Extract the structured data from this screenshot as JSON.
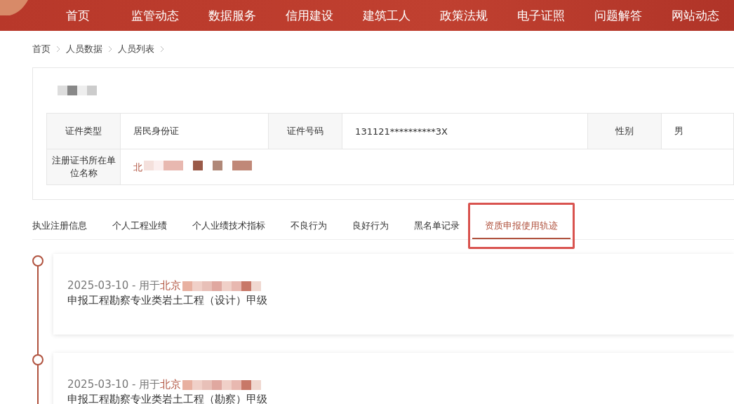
{
  "nav": [
    {
      "label": "首页",
      "selected": false
    },
    {
      "label": "监管动态",
      "selected": false
    },
    {
      "label": "数据服务",
      "selected": false
    },
    {
      "label": "信用建设",
      "selected": false
    },
    {
      "label": "建筑工人",
      "selected": false
    },
    {
      "label": "政策法规",
      "selected": false
    },
    {
      "label": "电子证照",
      "selected": false
    },
    {
      "label": "问题解答",
      "selected": false
    },
    {
      "label": "网站动态",
      "selected": false
    }
  ],
  "breadcrumb": [
    "首页",
    "人员数据",
    "人员列表"
  ],
  "info_table": {
    "rows": [
      {
        "cells": [
          {
            "kind": "label",
            "text": "证件类型"
          },
          {
            "kind": "value",
            "text": "居民身份证"
          },
          {
            "kind": "label",
            "text": "证件号码"
          },
          {
            "kind": "value",
            "text": "131121**********3X"
          },
          {
            "kind": "label",
            "text": "性别"
          },
          {
            "kind": "value",
            "text": "男"
          }
        ]
      },
      {
        "cells": [
          {
            "kind": "label",
            "text": "注册证书所在单位名称"
          },
          {
            "kind": "link",
            "text": "北",
            "colspan": 5
          }
        ]
      }
    ]
  },
  "tabs": [
    {
      "label": "执业注册信息",
      "selected": false,
      "highlighted": false
    },
    {
      "label": "个人工程业绩",
      "selected": false,
      "highlighted": false
    },
    {
      "label": "个人业绩技术指标",
      "selected": false,
      "highlighted": false
    },
    {
      "label": "不良行为",
      "selected": false,
      "highlighted": false
    },
    {
      "label": "良好行为",
      "selected": false,
      "highlighted": false
    },
    {
      "label": "黑名单记录",
      "selected": false,
      "highlighted": false
    },
    {
      "label": "资质申报使用轨迹",
      "selected": true,
      "highlighted": true
    }
  ],
  "timeline": [
    {
      "date": "2025-03-10 - 用于",
      "org": "北京",
      "description": "申报工程勘察专业类岩土工程（设计）甲级"
    },
    {
      "date": "2025-03-10 - 用于",
      "org": "北京",
      "description": "申报工程勘察专业类岩土工程（勘察）甲级"
    }
  ]
}
